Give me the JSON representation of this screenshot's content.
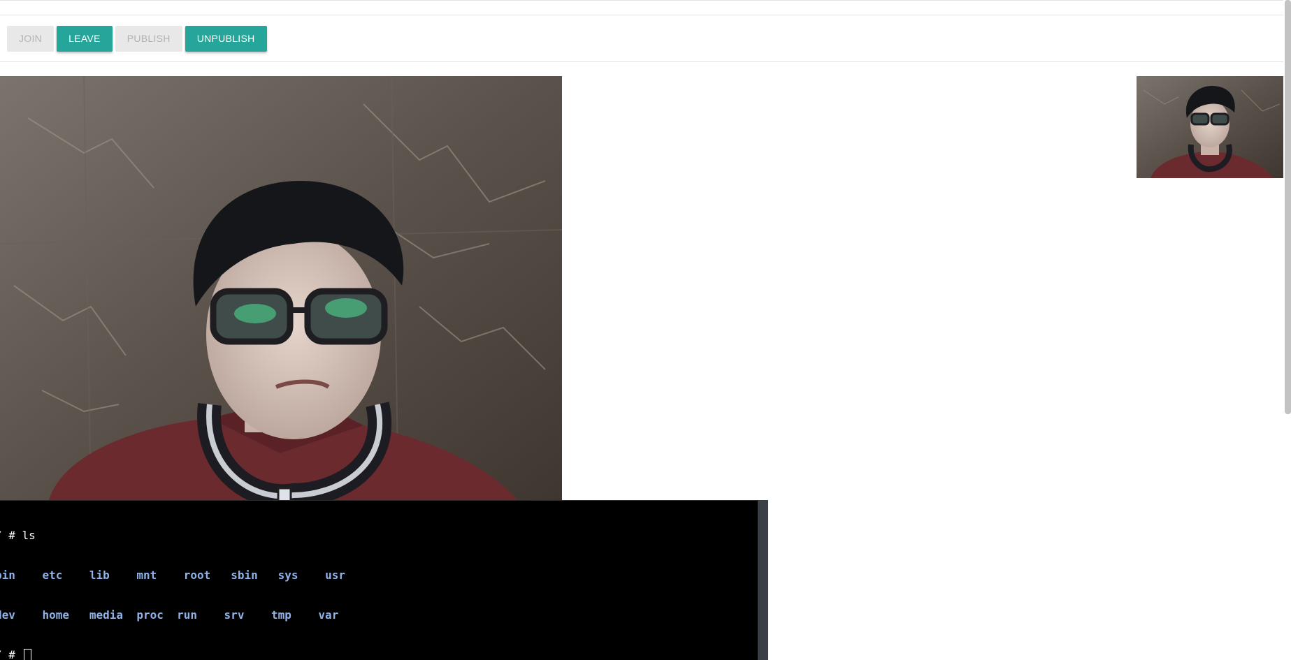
{
  "toolbar": {
    "buttons": [
      {
        "label": "JOIN",
        "state": "disabled"
      },
      {
        "label": "LEAVE",
        "state": "active"
      },
      {
        "label": "PUBLISH",
        "state": "disabled"
      },
      {
        "label": "UNPUBLISH",
        "state": "active"
      }
    ],
    "accent_color": "#26a69a"
  },
  "videos": {
    "remote": {
      "icon": "webcam-video-feed"
    },
    "local": {
      "icon": "webcam-video-preview"
    }
  },
  "terminal": {
    "line1": {
      "prompt": "/ # ",
      "command": "ls"
    },
    "row1": [
      "bin",
      "etc",
      "lib",
      "mnt",
      "root",
      "sbin",
      "sys",
      "usr"
    ],
    "row2": [
      "dev",
      "home",
      "media",
      "proc",
      "run",
      "srv",
      "tmp",
      "var"
    ],
    "line4": {
      "prompt": "/ # "
    },
    "dir_color": "#8fb3e8"
  }
}
